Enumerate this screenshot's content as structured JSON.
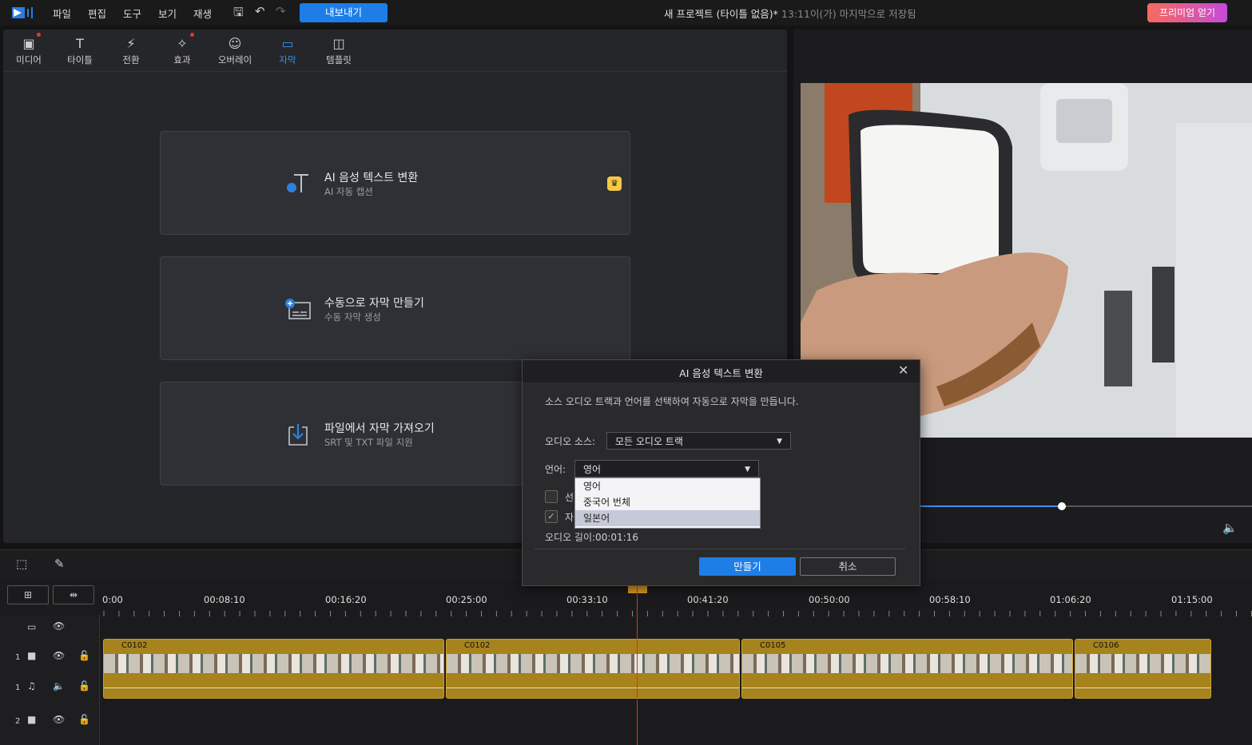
{
  "menu": [
    "파일",
    "편집",
    "도구",
    "보기",
    "재생"
  ],
  "export_label": "내보내기",
  "project": {
    "title": "새 프로젝트 (타이틀 없음)*",
    "saved": "13:11이(가) 마지막으로 저장됨"
  },
  "premium_label": "프리미엄 얻기",
  "tabs": [
    "미디어",
    "타이틀",
    "전환",
    "효과",
    "오버레이",
    "자막",
    "템플릿"
  ],
  "cards": [
    {
      "title": "AI 음성 텍스트 변환",
      "subtitle": "AI 자동 캡션"
    },
    {
      "title": "수동으로 자막 만들기",
      "subtitle": "수동 자막 생성"
    },
    {
      "title": "파일에서 자막 가져오기",
      "subtitle": "SRT 및 TXT 파일 지원"
    }
  ],
  "ruler": [
    "0:00",
    "00:08:10",
    "00:16:20",
    "00:25:00",
    "00:33:10",
    "00:41:20",
    "00:50:00",
    "00:58:10",
    "01:06:20",
    "01:15:00"
  ],
  "tracks": [
    "1",
    "1",
    "2"
  ],
  "clips": [
    "C0102",
    "C0102",
    "C0105",
    "C0106"
  ],
  "dialog": {
    "title": "AI 음성 텍스트 변환",
    "description": "소스 오디오 트랙과 언어를 선택하여 자동으로 자막을 만듭니다.",
    "audio_source_label": "오디오 소스:",
    "audio_source_value": "모든 오디오 트랙",
    "language_label": "언어:",
    "language_value": "영어",
    "options": [
      "영어",
      "중국어 번체",
      "일본어"
    ],
    "checkbox1_label": "선",
    "checkbox2_label": "자",
    "duration": "오디오 길이:00:01:16",
    "create_label": "만들기",
    "cancel_label": "취소"
  },
  "colors": {
    "accent": "#1e7ee8",
    "clip": "#a6831c",
    "playhead": "#e0312b"
  }
}
